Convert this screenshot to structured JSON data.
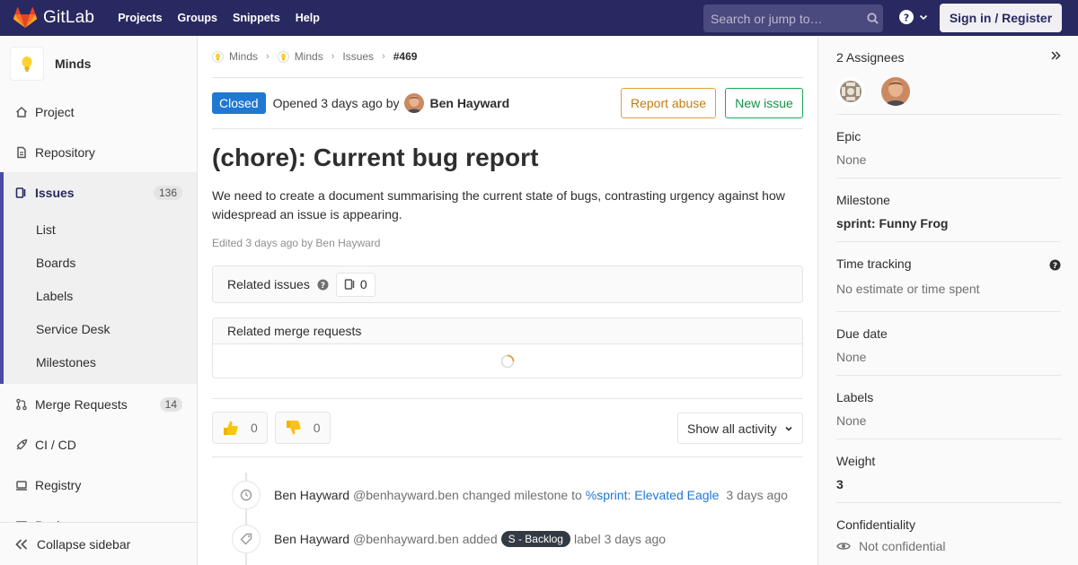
{
  "navbar": {
    "brand": "GitLab",
    "links": [
      "Projects",
      "Groups",
      "Snippets",
      "Help"
    ],
    "search_placeholder": "Search or jump to…",
    "signin_label": "Sign in / Register"
  },
  "sidebar": {
    "project_name": "Minds",
    "items": [
      {
        "label": "Project",
        "icon": "home-icon"
      },
      {
        "label": "Repository",
        "icon": "doc-icon"
      }
    ],
    "active": {
      "label": "Issues",
      "badge": "136",
      "icon": "issues-icon",
      "sub": [
        "List",
        "Boards",
        "Labels",
        "Service Desk",
        "Milestones"
      ]
    },
    "after": [
      {
        "label": "Merge Requests",
        "badge": "14",
        "icon": "merge-icon"
      },
      {
        "label": "CI / CD",
        "icon": "rocket-icon"
      },
      {
        "label": "Registry",
        "icon": "registry-icon"
      },
      {
        "label": "Packages",
        "icon": "package-icon"
      }
    ],
    "collapse_label": "Collapse sidebar"
  },
  "breadcrumbs": [
    "Minds",
    "Minds",
    "Issues",
    "#469"
  ],
  "issue": {
    "status": "Closed",
    "opened_text": "Opened 3 days ago by",
    "author": "Ben Hayward",
    "report_abuse": "Report abuse",
    "new_issue": "New issue",
    "title": "(chore): Current bug report",
    "description": "We need to create a document summarising the current state of bugs, contrasting urgency against how widespread an issue is appearing.",
    "edited": "Edited 3 days ago by Ben Hayward",
    "related_issues_title": "Related issues",
    "related_issues_count": "0",
    "related_mr_title": "Related merge requests",
    "thumbs_up_count": "0",
    "thumbs_down_count": "0",
    "activity_filter": "Show all activity"
  },
  "timeline": [
    {
      "author": "Ben Hayward",
      "handle": "@benhayward.ben",
      "action": "changed milestone to",
      "link": "%sprint: Elevated Eagle",
      "time": "3 days ago"
    },
    {
      "author": "Ben Hayward",
      "handle": "@benhayward.ben",
      "action": "added",
      "label": "S - Backlog",
      "suffix": "label",
      "time": "3 days ago"
    }
  ],
  "rightbar": {
    "assignees_title": "2 Assignees",
    "epic_title": "Epic",
    "epic_value": "None",
    "milestone_title": "Milestone",
    "milestone_value": "sprint: Funny Frog",
    "time_title": "Time tracking",
    "time_value": "No estimate or time spent",
    "due_title": "Due date",
    "due_value": "None",
    "labels_title": "Labels",
    "labels_value": "None",
    "weight_title": "Weight",
    "weight_value": "3",
    "confidentiality_title": "Confidentiality",
    "confidentiality_value": "Not confidential"
  },
  "colors": {
    "navbar": "#292961",
    "accent": "#1f78d1",
    "success": "#1aaa55",
    "warning": "#e0a03d"
  }
}
